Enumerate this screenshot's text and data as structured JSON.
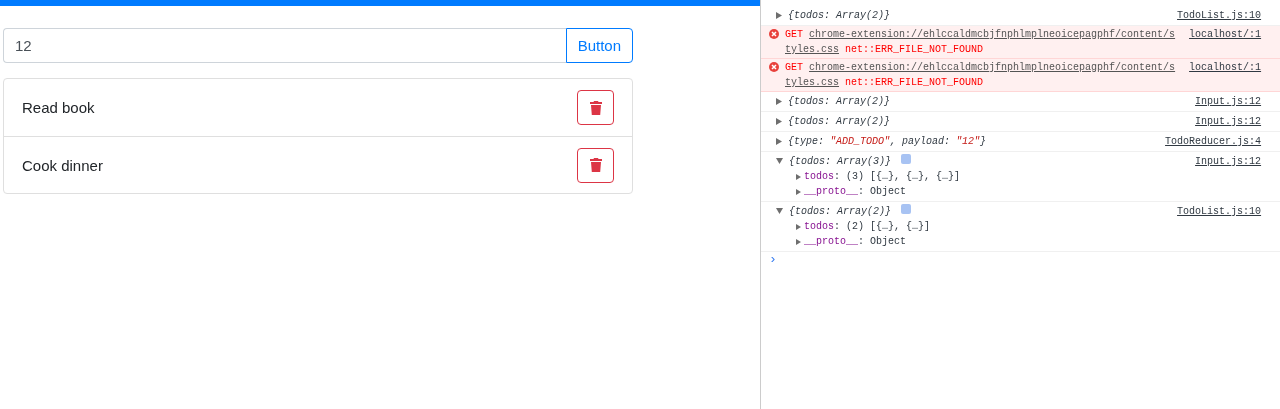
{
  "todo_app": {
    "input": {
      "value": "12"
    },
    "add_button": {
      "label": "Button"
    },
    "todos": [
      {
        "text": "Read book"
      },
      {
        "text": "Cook dinner"
      }
    ]
  },
  "console": {
    "messages": [
      {
        "kind": "log",
        "expanded": false,
        "parts": [
          {
            "text": "{todos: Array(2)}",
            "kind": "plain"
          }
        ],
        "source": "TodoList.js:10"
      },
      {
        "kind": "error",
        "method": "GET",
        "url": "chrome-extension://ehlccaldmcbjfnphlmplneoicepagphf/content/styles.css",
        "error_text": "net::ERR_FILE_NOT_FOUND",
        "source": "localhost/:1"
      },
      {
        "kind": "error",
        "method": "GET",
        "url": "chrome-extension://ehlccaldmcbjfnphlmplneoicepagphf/content/styles.css",
        "error_text": "net::ERR_FILE_NOT_FOUND",
        "source": "localhost/:1"
      },
      {
        "kind": "log",
        "expanded": false,
        "parts": [
          {
            "text": "{todos: Array(2)}",
            "kind": "plain"
          }
        ],
        "source": "Input.js:12"
      },
      {
        "kind": "log",
        "expanded": false,
        "parts": [
          {
            "text": "{todos: Array(2)}",
            "kind": "plain"
          }
        ],
        "source": "Input.js:12"
      },
      {
        "kind": "log",
        "expanded": false,
        "parts": [
          {
            "text": "{type: ",
            "kind": "plain"
          },
          {
            "text": "\"ADD_TODO\"",
            "kind": "string"
          },
          {
            "text": ", payload: ",
            "kind": "plain"
          },
          {
            "text": "\"12\"",
            "kind": "string"
          },
          {
            "text": "}",
            "kind": "plain"
          }
        ],
        "source": "TodoReducer.js:4"
      },
      {
        "kind": "log",
        "expanded": true,
        "parts": [
          {
            "text": "{todos: Array(3)}",
            "kind": "plain"
          }
        ],
        "source": "Input.js:12",
        "children": [
          {
            "parts": [
              {
                "text": "todos",
                "kind": "key"
              },
              {
                "text": ": (3) [{…}, {…}, {…}]",
                "kind": "plain"
              }
            ]
          },
          {
            "parts": [
              {
                "text": "__proto__",
                "kind": "key"
              },
              {
                "text": ": Object",
                "kind": "plain"
              }
            ]
          }
        ]
      },
      {
        "kind": "log",
        "expanded": true,
        "parts": [
          {
            "text": "{todos: Array(2)}",
            "kind": "plain"
          }
        ],
        "source": "TodoList.js:10",
        "children": [
          {
            "parts": [
              {
                "text": "todos",
                "kind": "key"
              },
              {
                "text": ": (2) [{…}, {…}]",
                "kind": "plain"
              }
            ]
          },
          {
            "parts": [
              {
                "text": "__proto__",
                "kind": "key"
              },
              {
                "text": ": Object",
                "kind": "plain"
              }
            ]
          }
        ]
      }
    ],
    "prompt": "›"
  }
}
